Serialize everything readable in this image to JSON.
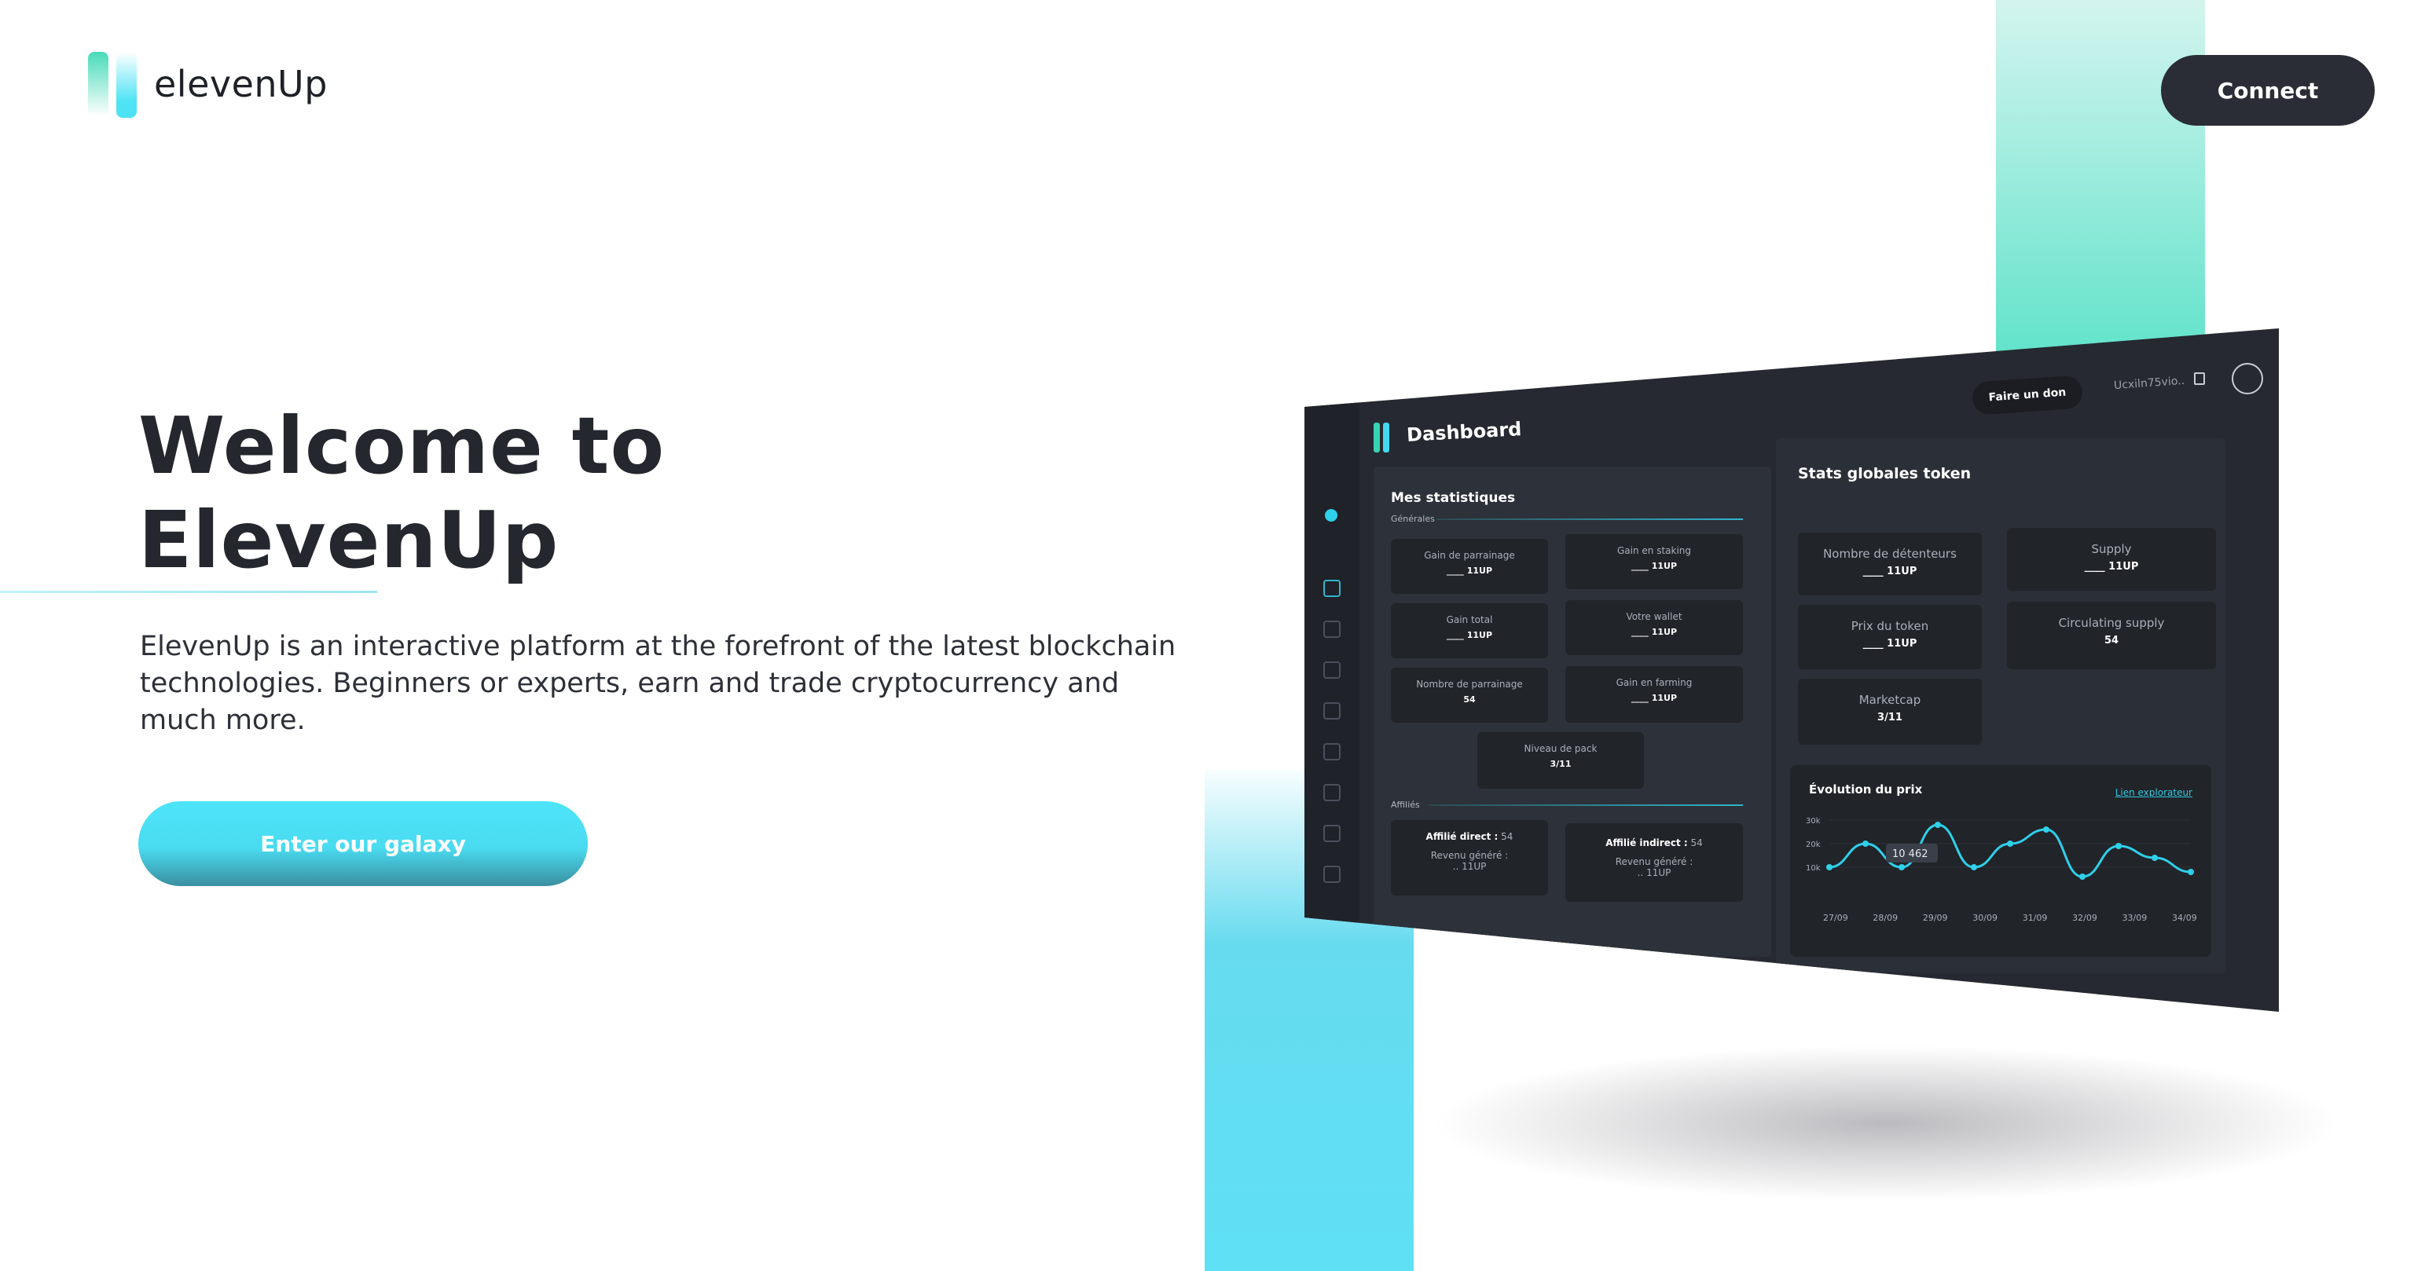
{
  "header": {
    "logo_text": "elevenUp",
    "connect_label": "Connect"
  },
  "hero": {
    "title_line1": "Welcome to",
    "title_line2": "ElevenUp",
    "description": "ElevenUp is an interactive platform at the forefront of the latest blockchain technologies. Beginners or experts, earn and trade cryptocurrency and much more.",
    "cta_label": "Enter our galaxy"
  },
  "colors": {
    "accent_cyan": "#4de4fa",
    "accent_teal": "#63e3cb",
    "dark": "#2a2d35"
  },
  "dashboard": {
    "title": "Dashboard",
    "donate_label": "Faire un don",
    "wallet_address": "Ucxiln75vio..",
    "mes_stats": {
      "title": "Mes statistiques",
      "general_label": "Générales",
      "cards": [
        {
          "label": "Gain de parrainage",
          "value": "____ 11UP"
        },
        {
          "label": "Gain en staking",
          "value": "____ 11UP"
        },
        {
          "label": "Gain total",
          "value": "____ 11UP"
        },
        {
          "label": "Votre wallet",
          "value": "____ 11UP"
        },
        {
          "label": "Nombre de parrainage",
          "value": "54"
        },
        {
          "label": "Gain en farming",
          "value": "____ 11UP"
        },
        {
          "label": "Niveau de pack",
          "value": "3/11"
        }
      ],
      "affiliates_label": "Affiliés",
      "affiliates": [
        {
          "label": "Affilié direct :",
          "count": "54",
          "rev_label": "Revenu généré :",
          "rev_value": ".. 11UP"
        },
        {
          "label": "Affilié indirect :",
          "count": "54",
          "rev_label": "Revenu généré :",
          "rev_value": ".. 11UP"
        }
      ]
    },
    "stats_globales": {
      "title": "Stats globales token",
      "cards": [
        {
          "label": "Nombre de détenteurs",
          "value": "____ 11UP"
        },
        {
          "label": "Supply",
          "value": "____ 11UP"
        },
        {
          "label": "Prix du token",
          "value": "____ 11UP"
        },
        {
          "label": "Circulating supply",
          "value": "54"
        },
        {
          "label": "Marketcap",
          "value": "3/11"
        }
      ]
    },
    "price_chart": {
      "title": "Évolution du prix",
      "link_label": "Lien explorateur",
      "tooltip": "10 462"
    }
  },
  "chart_data": {
    "type": "line",
    "title": "Évolution du prix",
    "x": [
      "27/09",
      "28/09",
      "29/09",
      "30/09",
      "31/09",
      "32/09",
      "33/09",
      "34/09"
    ],
    "y_ticks": [
      "30k",
      "20k",
      "10k"
    ],
    "series": [
      {
        "values": [
          10,
          20,
          10,
          28,
          10,
          20,
          26,
          6,
          19,
          14,
          8
        ]
      }
    ],
    "ylim": [
      0,
      30
    ],
    "grid": true
  }
}
